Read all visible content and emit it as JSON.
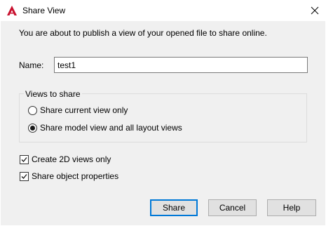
{
  "window": {
    "title": "Share View"
  },
  "dialog": {
    "intro_text": "You are about to publish a view of your opened file to share online.",
    "name_label": "Name:",
    "name_value": "test1",
    "views_group": {
      "legend": "Views to share",
      "options": [
        {
          "label": "Share current view only",
          "selected": false
        },
        {
          "label": "Share model view and all layout views",
          "selected": true
        }
      ]
    },
    "checkboxes": [
      {
        "label": "Create 2D views only",
        "checked": true
      },
      {
        "label": "Share object properties",
        "checked": true
      }
    ],
    "buttons": {
      "share": "Share",
      "cancel": "Cancel",
      "help": "Help"
    }
  },
  "colors": {
    "accent": "#0078d7",
    "app_icon": "#c8102e",
    "dialog_bg": "#f0f0f0"
  },
  "icons": {
    "app": "autocad-icon",
    "close": "close-icon",
    "check": "check-icon"
  }
}
